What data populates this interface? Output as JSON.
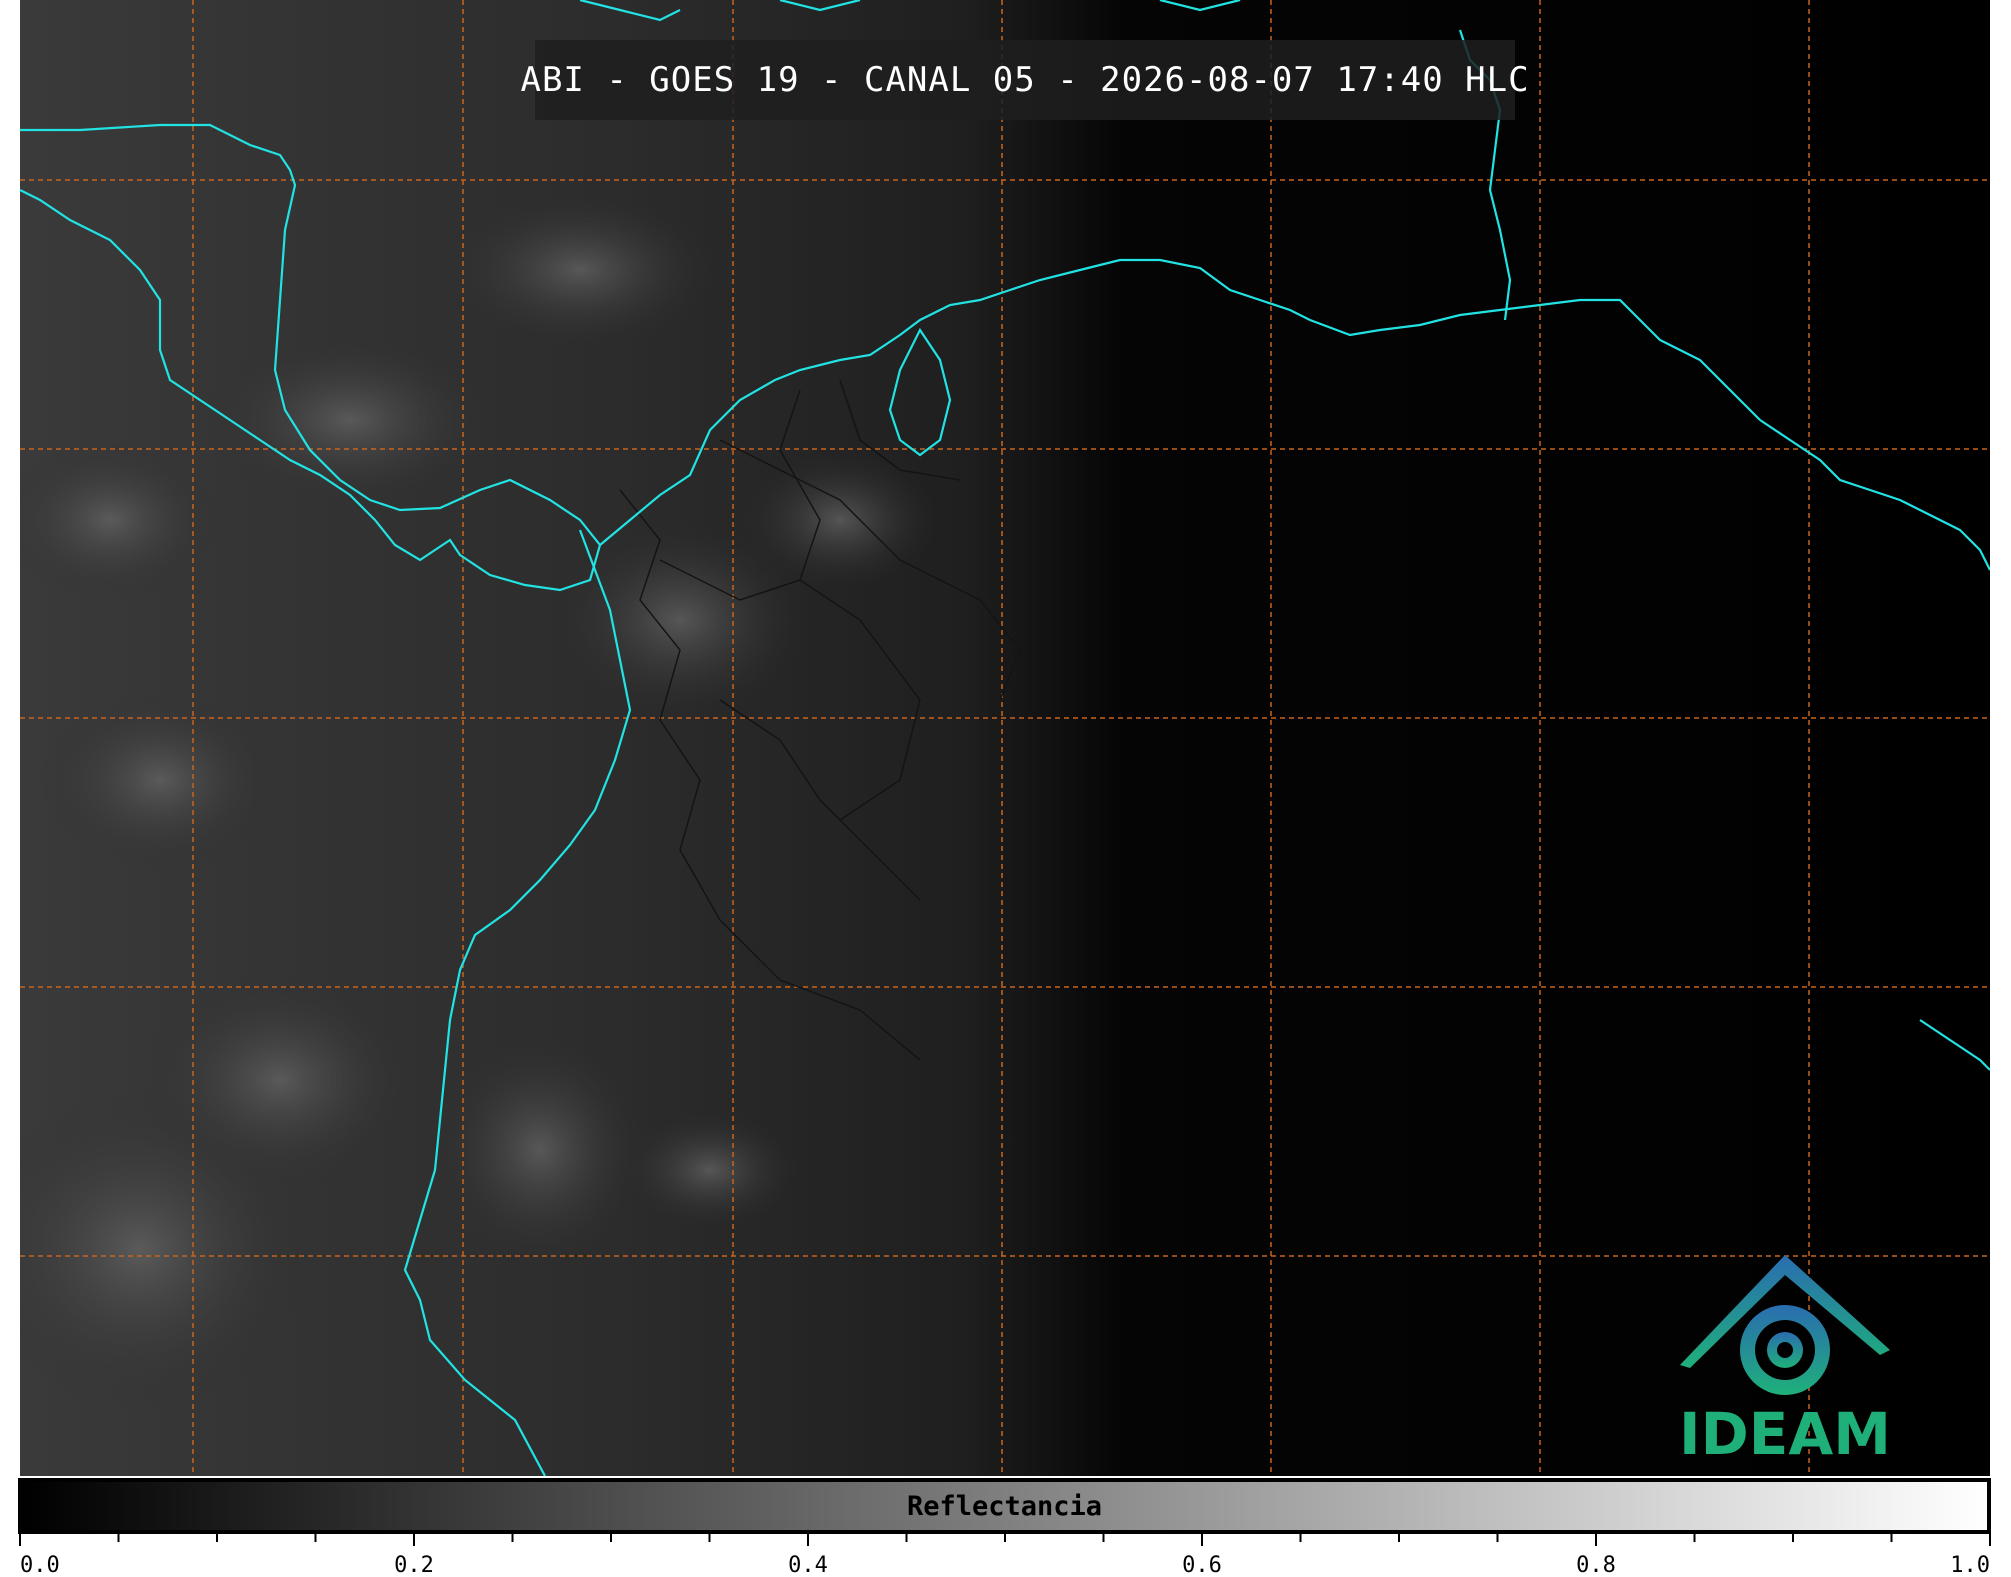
{
  "title": "ABI - GOES 19 - CANAL 05 - 2026-08-07 17:40 HLC",
  "colorbar": {
    "label": "Reflectancia",
    "ticks": [
      "0.0",
      "0.2",
      "0.4",
      "0.6",
      "0.8",
      "1.0"
    ],
    "gradient_from": "#000000",
    "gradient_to": "#ffffff"
  },
  "logo": {
    "text": "IDEAM",
    "color_blue": "#2a6db0",
    "color_green": "#1fb07a"
  },
  "map": {
    "background": "#000000",
    "coastline_color": "#22e3e3",
    "gridline_color": "#c8651e",
    "border_color": "#111111",
    "gridlines": "dashed"
  }
}
